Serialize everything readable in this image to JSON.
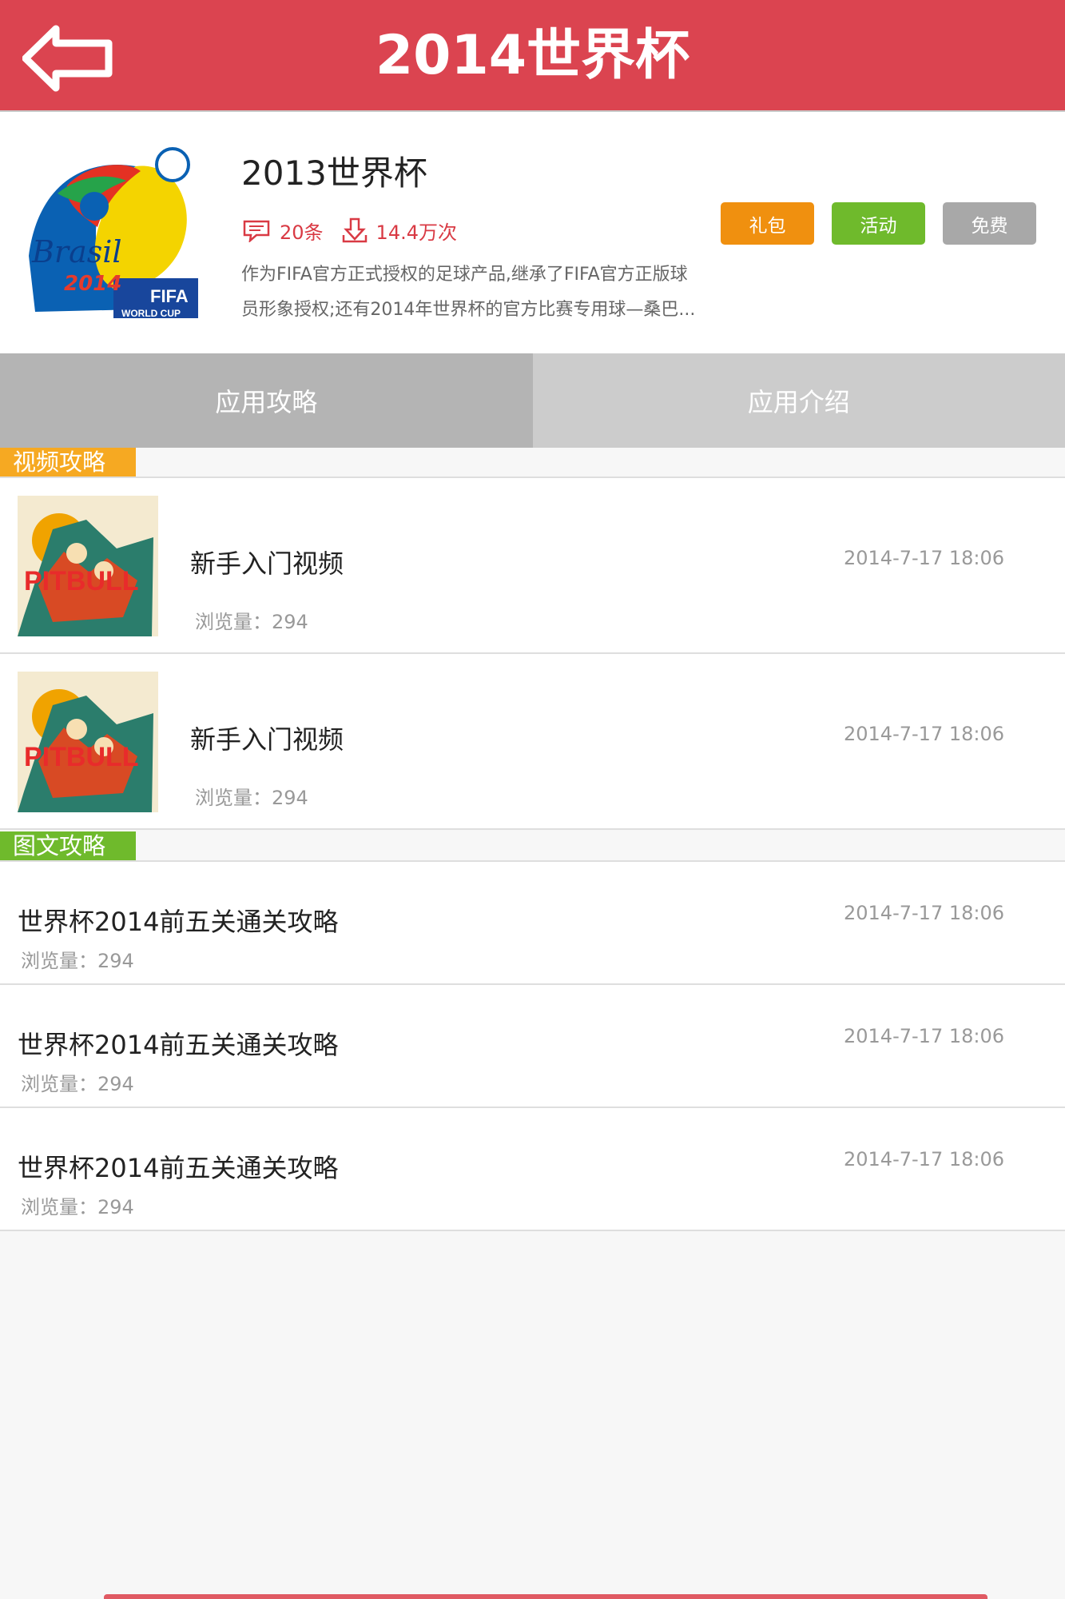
{
  "header": {
    "title": "2014世界杯",
    "back_icon": "back-arrow-icon"
  },
  "app": {
    "name": "2013世界杯",
    "logo_text": "Brasil 2014 FIFA WORLD CUP",
    "comment_count": "20条",
    "download_count": "14.4万次",
    "tags": [
      "礼包",
      "活动",
      "免费"
    ],
    "description_line1": "作为FIFA官方正式授权的足球产品,继承了FIFA官方正版球",
    "description_line2": "员形象授权;还有2014年世界杯的官方比赛专用球—桑巴..."
  },
  "tabs": [
    {
      "label": "应用攻略",
      "active": true
    },
    {
      "label": "应用介绍",
      "active": false
    }
  ],
  "video_section": {
    "label": "视频攻略",
    "items": [
      {
        "title": "新手入门视频",
        "views": "浏览量：294",
        "date": "2014-7-17 18:06",
        "thumb_text": "PITBULL"
      },
      {
        "title": "新手入门视频",
        "views": "浏览量：294",
        "date": "2014-7-17 18:06",
        "thumb_text": "PITBULL"
      }
    ]
  },
  "article_section": {
    "label": "图文攻略",
    "items": [
      {
        "title": "世界杯2014前五关通关攻略",
        "views": "浏览量：294",
        "date": "2014-7-17 18:06"
      },
      {
        "title": "世界杯2014前五关通关攻略",
        "views": "浏览量：294",
        "date": "2014-7-17 18:06"
      },
      {
        "title": "世界杯2014前五关通关攻略",
        "views": "浏览量：294",
        "date": "2014-7-17 18:06"
      }
    ]
  },
  "colors": {
    "header": "#db4450",
    "tag_gift": "#f0900f",
    "tag_event": "#6fba2c",
    "tag_free": "#a8a8a8",
    "video_label": "#f6a922",
    "article_label": "#6fba2c"
  }
}
